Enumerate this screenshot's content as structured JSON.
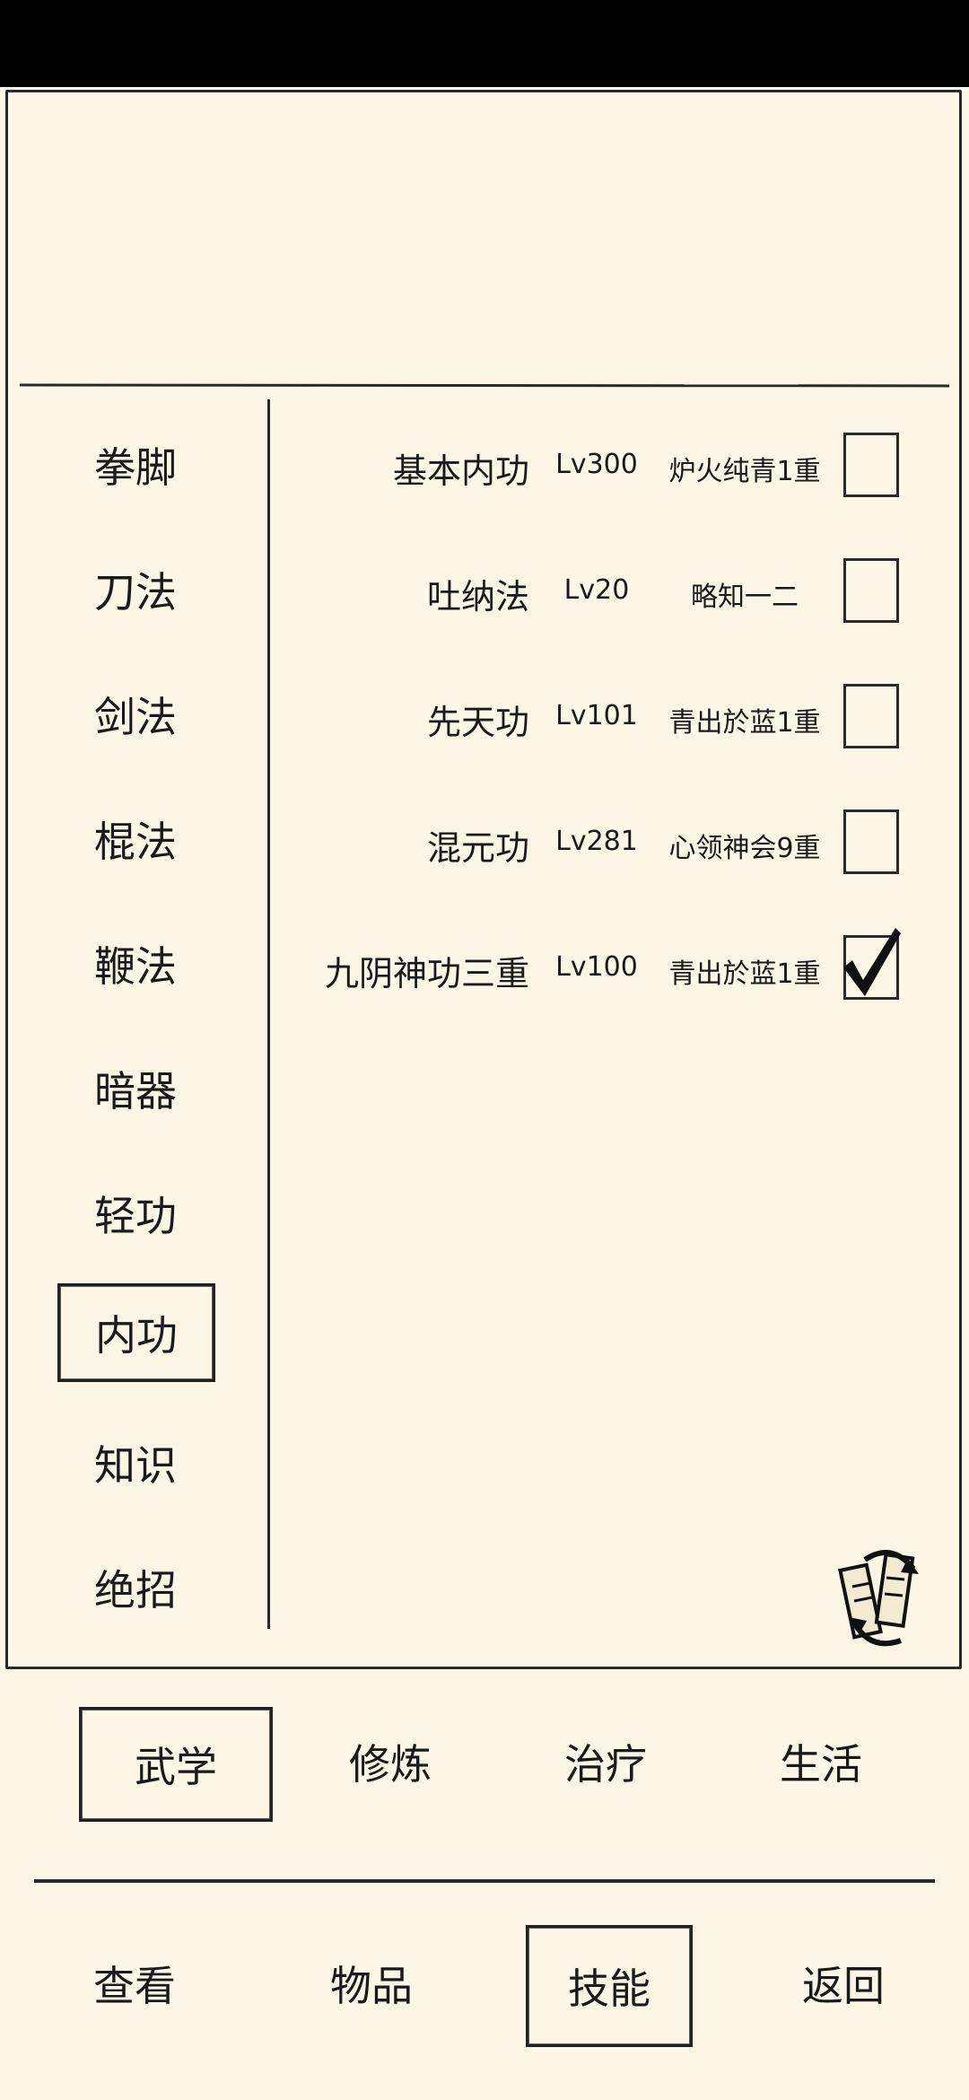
{
  "categories": [
    {
      "label": "拳脚"
    },
    {
      "label": "刀法"
    },
    {
      "label": "剑法"
    },
    {
      "label": "棍法"
    },
    {
      "label": "鞭法"
    },
    {
      "label": "暗器"
    },
    {
      "label": "轻功"
    },
    {
      "label": "内功",
      "active": true
    },
    {
      "label": "知识"
    },
    {
      "label": "绝招"
    }
  ],
  "skills": [
    {
      "name": "基本内功",
      "level": "Lv300",
      "rank": "炉火纯青1重",
      "checked": false
    },
    {
      "name": "吐纳法",
      "level": "Lv20",
      "rank": "略知一二",
      "checked": false
    },
    {
      "name": "先天功",
      "level": "Lv101",
      "rank": "青出於蓝1重",
      "checked": false
    },
    {
      "name": "混元功",
      "level": "Lv281",
      "rank": "心领神会9重",
      "checked": false
    },
    {
      "name": "九阴神功三重",
      "level": "Lv100",
      "rank": "青出於蓝1重",
      "checked": true
    }
  ],
  "tabs": [
    {
      "label": "武学",
      "active": true
    },
    {
      "label": "修炼"
    },
    {
      "label": "治疗"
    },
    {
      "label": "生活"
    }
  ],
  "nav": [
    {
      "label": "查看"
    },
    {
      "label": "物品"
    },
    {
      "label": "技能",
      "active": true
    },
    {
      "label": "返回"
    }
  ],
  "icons": {
    "refresh": "refresh-scroll-icon",
    "check": "checkmark-icon"
  }
}
